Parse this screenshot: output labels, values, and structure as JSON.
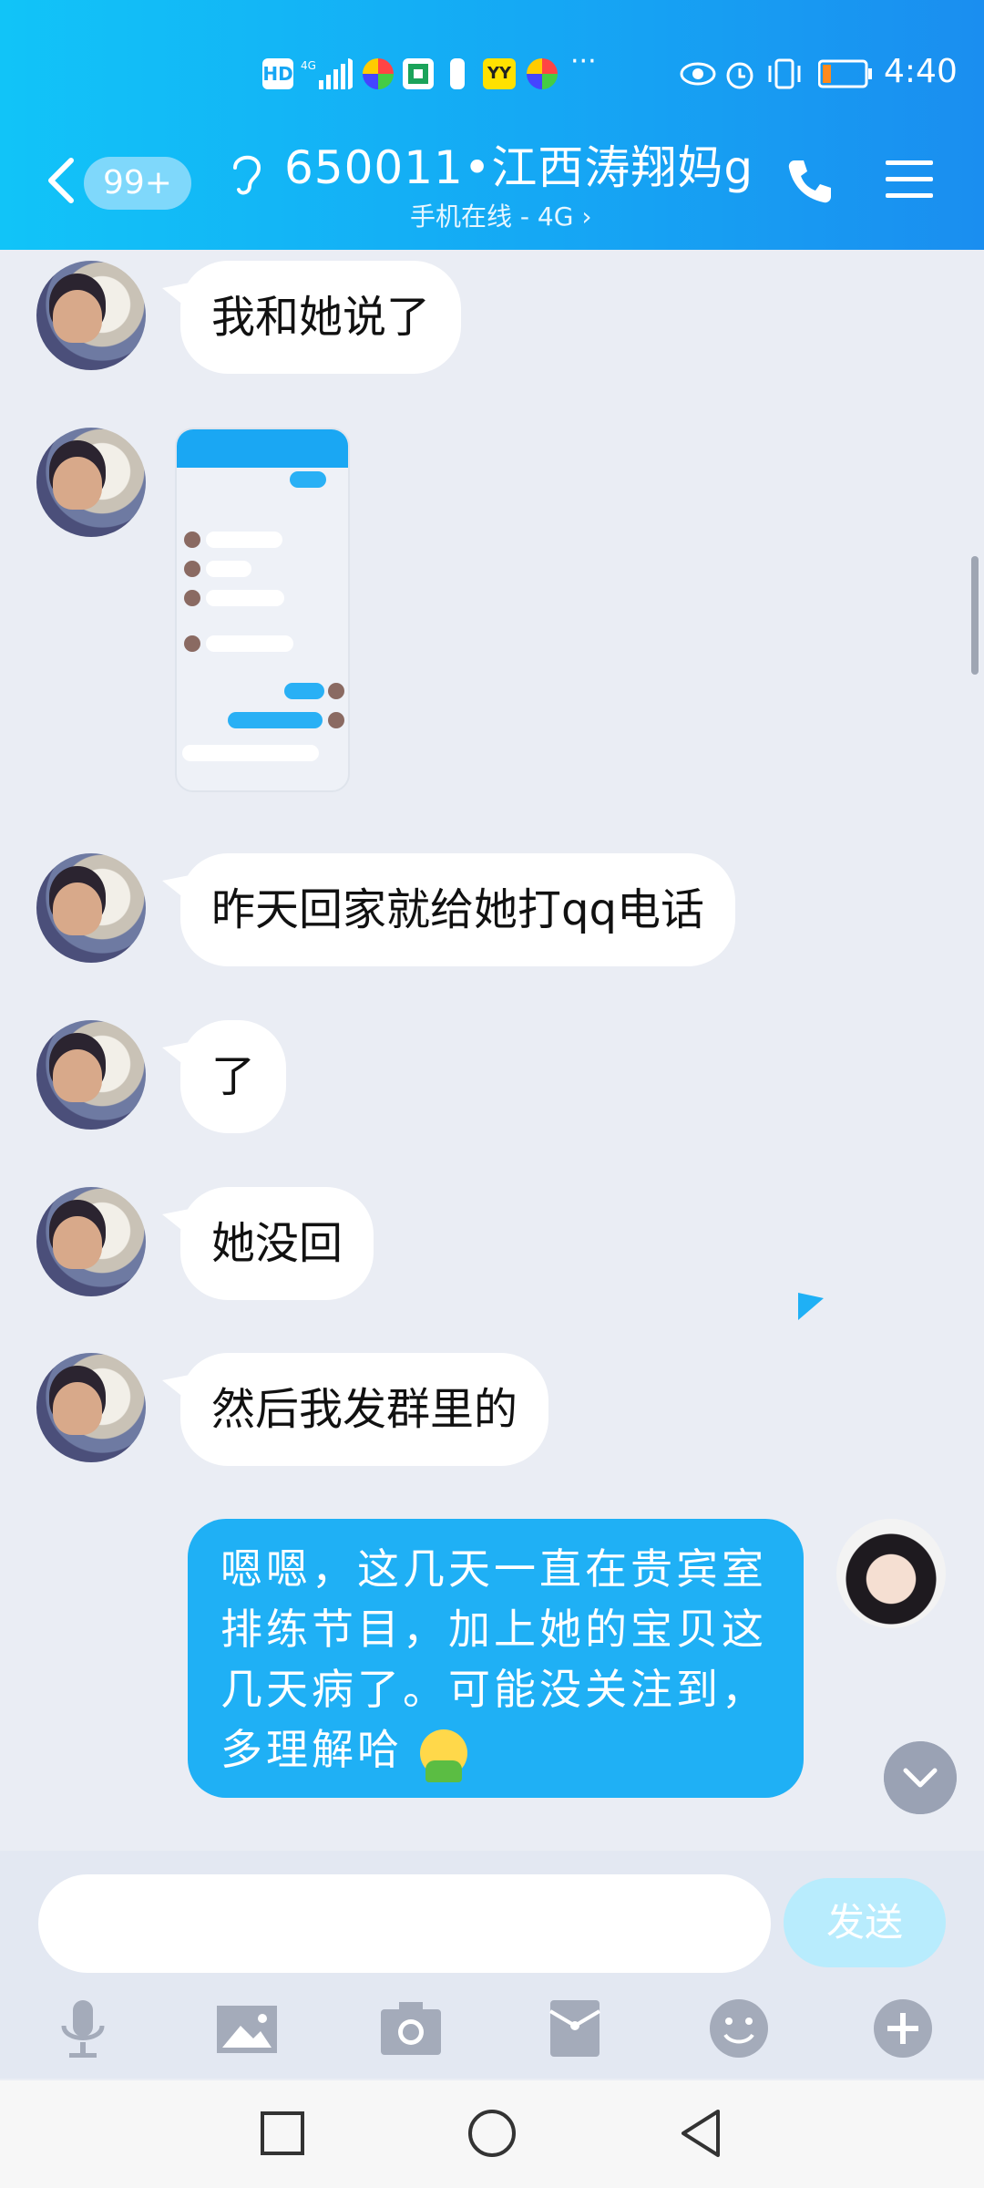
{
  "status_bar": {
    "time": "4:40",
    "icons": [
      "hd-icon",
      "4g-signal-icon",
      "app-notification-icon",
      "app-notification-icon",
      "battery-saver-icon",
      "yy-app-icon",
      "app-notification-icon",
      "more-notifications-icon",
      "eye-icon",
      "alarm-icon",
      "vibrate-icon",
      "battery-icon"
    ],
    "hd_label": "HD",
    "yy_label": "YY",
    "more_label": "···",
    "battery_level": 0.2
  },
  "header": {
    "unread_count": "99+",
    "title": "650011•江西涛翔妈g...",
    "subtitle": "手机在线 - 4G ›"
  },
  "messages": [
    {
      "sender": "other",
      "type": "text",
      "text": "我和她说了"
    },
    {
      "sender": "other",
      "type": "image",
      "caption": ""
    },
    {
      "sender": "other",
      "type": "text",
      "text": "昨天回家就给她打qq电话"
    },
    {
      "sender": "other",
      "type": "text",
      "text": "了"
    },
    {
      "sender": "other",
      "type": "text",
      "text": "她没回"
    },
    {
      "sender": "other",
      "type": "text",
      "text": "然后我发群里的"
    },
    {
      "sender": "me",
      "type": "text",
      "text": "嗯嗯，这几天一直在贵宾室排练节目，加上她的宝贝这几天病了。可能没关注到，多理解哈"
    }
  ],
  "input": {
    "placeholder": "",
    "send_label": "发送"
  },
  "toolbar": [
    "mic-icon",
    "image-icon",
    "camera-icon",
    "red-packet-icon",
    "emoji-icon",
    "plus-icon"
  ],
  "colors": {
    "header_start": "#11c4f8",
    "header_end": "#1a8ef0",
    "my_bubble": "#1fb0f5",
    "send_disabled": "#b8ecfd",
    "background": "#eaedf4"
  }
}
